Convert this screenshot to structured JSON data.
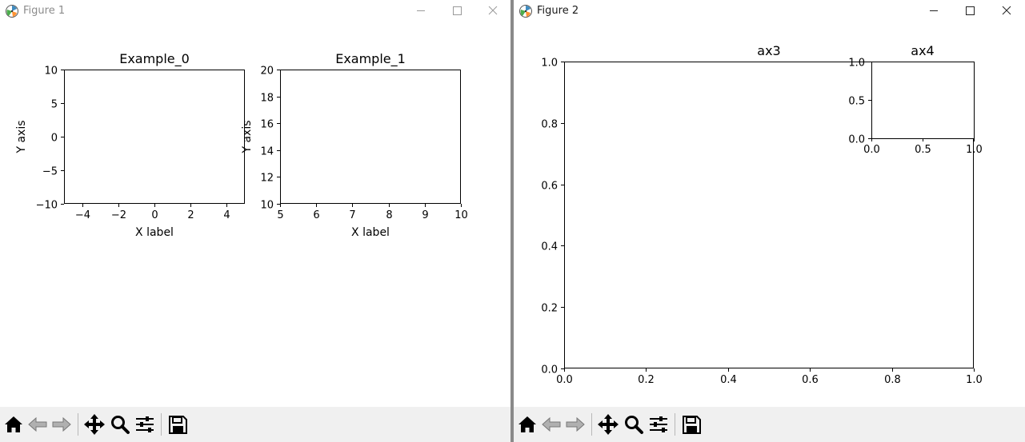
{
  "windows": [
    {
      "title": "Figure 1",
      "controls": {
        "minimize_icon": "minimize-icon",
        "maximize_icon": "maximize-icon",
        "close_icon": "close-icon"
      },
      "toolbar": [
        "home-icon",
        "back-arrow-icon",
        "forward-arrow-icon",
        "pan-icon",
        "zoom-icon",
        "configure-subplots-icon",
        "save-icon"
      ]
    },
    {
      "title": "Figure 2",
      "controls": {
        "minimize_icon": "minimize-icon",
        "maximize_icon": "maximize-icon",
        "close_icon": "close-icon"
      },
      "toolbar": [
        "home-icon",
        "back-arrow-icon",
        "forward-arrow-icon",
        "pan-icon",
        "zoom-icon",
        "configure-subplots-icon",
        "save-icon"
      ]
    }
  ],
  "chart_data": [
    {
      "figure": "Figure 1",
      "type": "line",
      "title": "Example_0",
      "xlabel": "X label",
      "ylabel": "Y axis",
      "xlim": [
        -5,
        5
      ],
      "ylim": [
        -10,
        10
      ],
      "xticks": [
        "−4",
        "−2",
        "0",
        "2",
        "4"
      ],
      "xtick_values": [
        -4,
        -2,
        0,
        2,
        4
      ],
      "yticks": [
        "−10",
        "−5",
        "0",
        "5",
        "10"
      ],
      "ytick_values": [
        -10,
        -5,
        0,
        5,
        10
      ],
      "series": []
    },
    {
      "figure": "Figure 1",
      "type": "line",
      "title": "Example_1",
      "xlabel": "X label",
      "ylabel": "Y axis",
      "xlim": [
        5,
        10
      ],
      "ylim": [
        10,
        20
      ],
      "xticks": [
        "5",
        "6",
        "7",
        "8",
        "9",
        "10"
      ],
      "xtick_values": [
        5,
        6,
        7,
        8,
        9,
        10
      ],
      "yticks": [
        "10",
        "12",
        "14",
        "16",
        "18",
        "20"
      ],
      "ytick_values": [
        10,
        12,
        14,
        16,
        18,
        20
      ],
      "series": []
    },
    {
      "figure": "Figure 2",
      "type": "line",
      "title": "ax3",
      "xlabel": "",
      "ylabel": "",
      "xlim": [
        0,
        1
      ],
      "ylim": [
        0,
        1
      ],
      "xticks": [
        "0.0",
        "0.2",
        "0.4",
        "0.6",
        "0.8",
        "1.0"
      ],
      "xtick_values": [
        0,
        0.2,
        0.4,
        0.6,
        0.8,
        1.0
      ],
      "yticks": [
        "0.0",
        "0.2",
        "0.4",
        "0.6",
        "0.8",
        "1.0"
      ],
      "ytick_values": [
        0,
        0.2,
        0.4,
        0.6,
        0.8,
        1.0
      ],
      "series": []
    },
    {
      "figure": "Figure 2",
      "type": "line",
      "title": "ax4",
      "xlabel": "",
      "ylabel": "",
      "xlim": [
        0,
        1
      ],
      "ylim": [
        0,
        1
      ],
      "xticks": [
        "0.0",
        "0.5",
        "1.0"
      ],
      "xtick_values": [
        0,
        0.5,
        1.0
      ],
      "yticks": [
        "0.0",
        "0.5",
        "1.0"
      ],
      "ytick_values": [
        0,
        0.5,
        1.0
      ],
      "series": []
    }
  ]
}
